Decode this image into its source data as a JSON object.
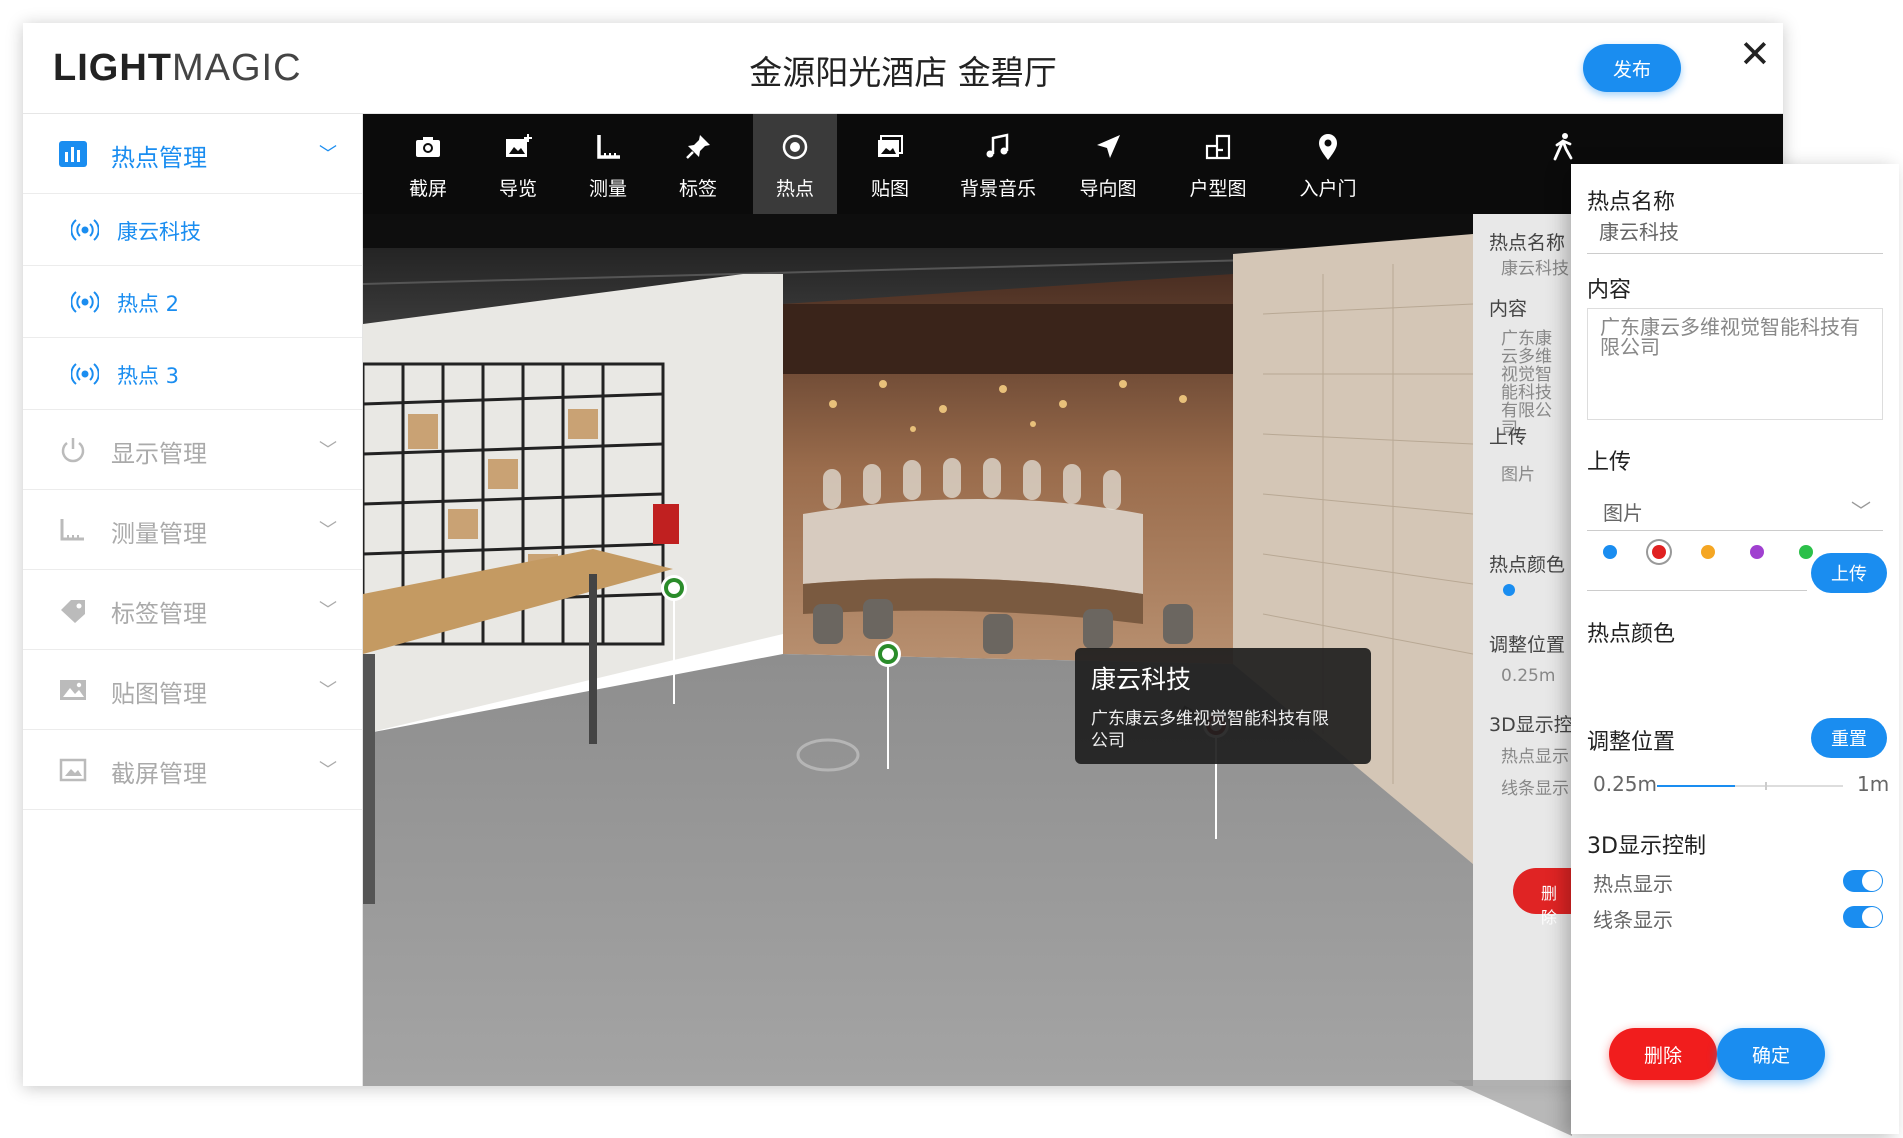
{
  "header": {
    "logo_bold": "LIGHT",
    "logo_light": "MAGIC",
    "title": "金源阳光酒店 金碧厅",
    "publish_label": "发布",
    "close_glyph": "✕"
  },
  "sidebar": {
    "groups": [
      {
        "label": "热点管理",
        "icon": "bar-chart-icon"
      },
      {
        "label": "显示管理",
        "icon": "power-icon"
      },
      {
        "label": "测量管理",
        "icon": "ruler-icon"
      },
      {
        "label": "标签管理",
        "icon": "tag-icon"
      },
      {
        "label": "贴图管理",
        "icon": "image-icon"
      },
      {
        "label": "截屏管理",
        "icon": "screenshot-icon"
      }
    ],
    "hotspots": [
      "康云科技",
      "热点 2",
      "热点 3"
    ]
  },
  "toolbar": {
    "items": [
      "截屏",
      "导览",
      "测量",
      "标签",
      "热点",
      "贴图",
      "背景音乐",
      "导向图",
      "户型图",
      "入户门"
    ],
    "active": "热点"
  },
  "tooltip": {
    "title": "康云科技",
    "body": "广东康云多维视觉智能科技有限公司"
  },
  "back_panel": {
    "name_label": "热点名称",
    "name_value": "康云科技",
    "content_label": "内容",
    "content_value": "广东康云多维视觉智能科技有限公司",
    "upload_label": "上传",
    "upload_type": "图片",
    "color_label": "热点颜色",
    "position_label": "调整位置",
    "slider_min": "0.25m",
    "display_label": "3D显示控制",
    "hotspot_display": "热点显示",
    "line_display": "线条显示",
    "delete_label": "删除"
  },
  "panel": {
    "name_label": "热点名称",
    "name_value": "康云科技",
    "content_label": "内容",
    "content_value": "广东康云多维视觉智能科技有限公司",
    "upload_label": "上传",
    "upload_type": "图片",
    "upload_button": "上传",
    "color_label": "热点颜色",
    "colors": [
      "#1a8df0",
      "#e02020",
      "#f5a623",
      "#a040d0",
      "#2cc04a"
    ],
    "selected_color": "#e02020",
    "position_label": "调整位置",
    "reset_button": "重置",
    "slider_min": "0.25m",
    "slider_max": "1m",
    "slider_value_fraction": 0.42,
    "display_label": "3D显示控制",
    "hotspot_display": "热点显示",
    "hotspot_display_on": true,
    "line_display": "线条显示",
    "line_display_on": true,
    "delete_button": "删除",
    "confirm_button": "确定"
  }
}
